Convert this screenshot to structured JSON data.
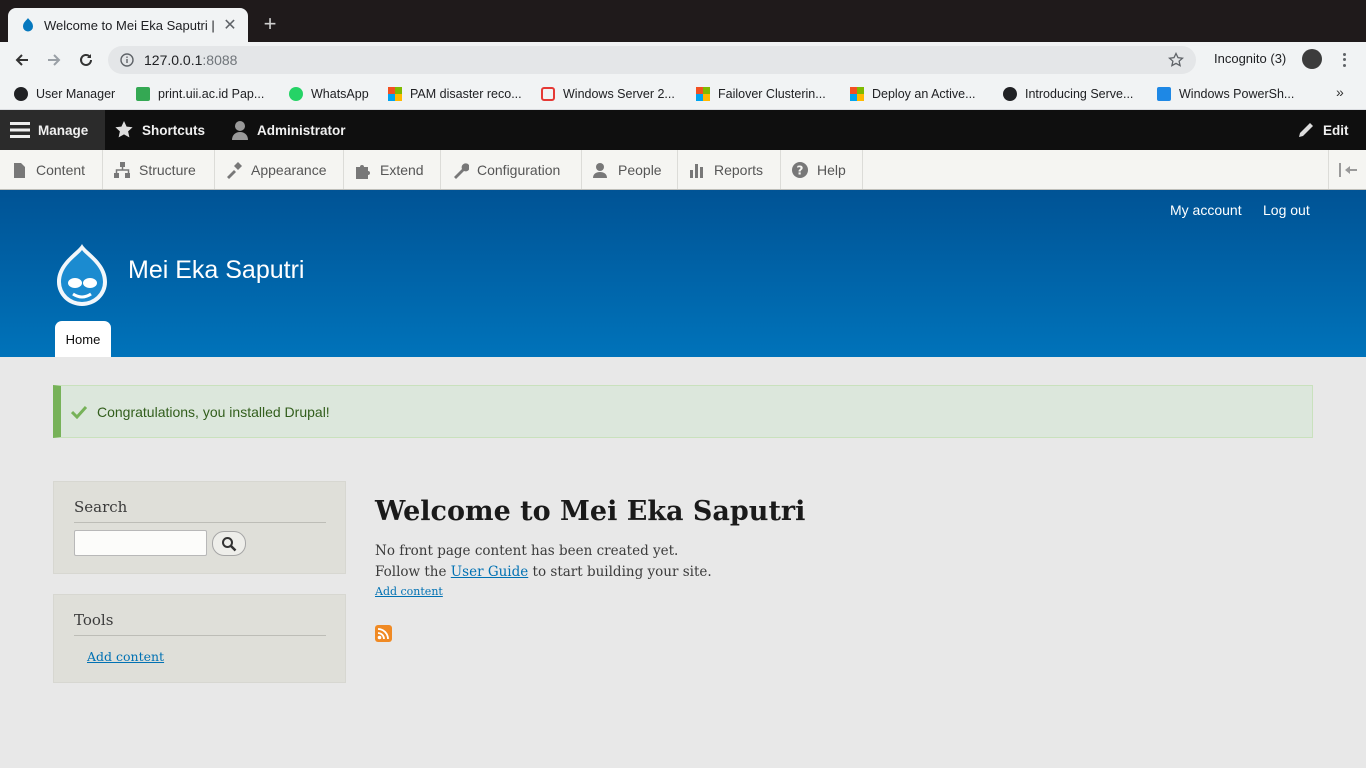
{
  "browser": {
    "tab_title": "Welcome to Mei Eka Saputri | M",
    "url_host": "127.0.0.1",
    "url_port": ":8088",
    "profile": "Incognito (3)",
    "bookmarks": [
      {
        "label": "User Manager",
        "icon": "globe-icon",
        "color": "#202124"
      },
      {
        "label": "print.uii.ac.id Pap...",
        "icon": "printer-icon",
        "color": "#34a853"
      },
      {
        "label": "WhatsApp",
        "icon": "whatsapp-icon",
        "color": "#25d366"
      },
      {
        "label": "PAM disaster reco...",
        "icon": "microsoft-icon",
        "color": "#f25022"
      },
      {
        "label": "Windows Server 2...",
        "icon": "ig-icon",
        "color": "#e53935"
      },
      {
        "label": "Failover Clusterin...",
        "icon": "microsoft-icon",
        "color": "#f25022"
      },
      {
        "label": "Deploy an Active...",
        "icon": "microsoft-icon",
        "color": "#f25022"
      },
      {
        "label": "Introducing Serve...",
        "icon": "globe-icon",
        "color": "#202124"
      },
      {
        "label": "Windows PowerSh...",
        "icon": "itpro-icon",
        "color": "#1e88e5"
      }
    ]
  },
  "admin_toolbar": {
    "manage": "Manage",
    "shortcuts": "Shortcuts",
    "user": "Administrator",
    "edit": "Edit"
  },
  "admin_menu": [
    {
      "label": "Content",
      "icon": "content-icon"
    },
    {
      "label": "Structure",
      "icon": "structure-icon"
    },
    {
      "label": "Appearance",
      "icon": "appearance-icon"
    },
    {
      "label": "Extend",
      "icon": "extend-icon"
    },
    {
      "label": "Configuration",
      "icon": "configuration-icon"
    },
    {
      "label": "People",
      "icon": "people-icon"
    },
    {
      "label": "Reports",
      "icon": "reports-icon"
    },
    {
      "label": "Help",
      "icon": "help-icon"
    }
  ],
  "header": {
    "account_link": "My account",
    "logout_link": "Log out",
    "site_name": "Mei Eka Saputri",
    "home_tab": "Home"
  },
  "status_message": "Congratulations, you installed Drupal!",
  "sidebar": {
    "search_title": "Search",
    "tools_title": "Tools",
    "tools_link": "Add content"
  },
  "main": {
    "title": "Welcome to Mei Eka Saputri",
    "line1": "No front page content has been created yet.",
    "line2_prefix": "Follow the ",
    "line2_link": "User Guide",
    "line2_suffix": " to start building your site.",
    "add_content": "Add content"
  },
  "colors": {
    "header_top": "#005395",
    "header_bottom": "#0073ba",
    "status_accent": "#77b259",
    "link": "#0071b3"
  }
}
